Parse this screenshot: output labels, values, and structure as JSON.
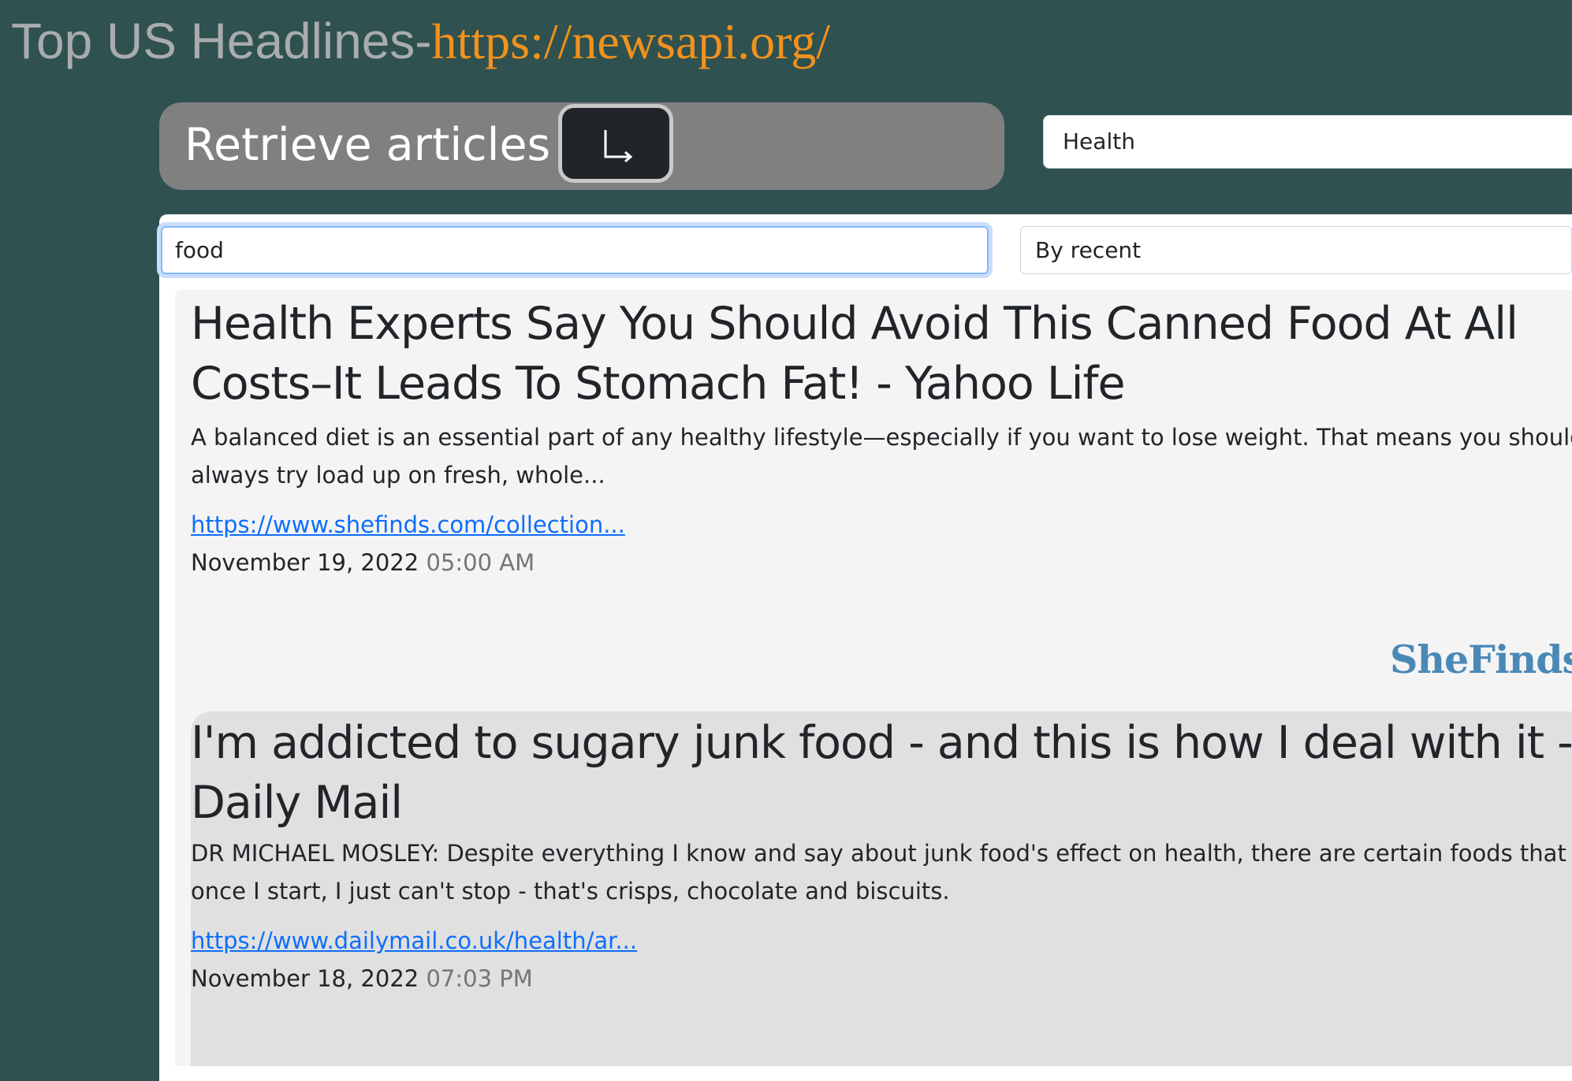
{
  "header": {
    "title": "Top US Headlines-",
    "link": "https://newsapi.org/"
  },
  "controls": {
    "retrieve_label": "Retrieve articles",
    "retrieve_icon": "return-arrow-icon",
    "category_value": "Health",
    "search_value": "food",
    "sort_value": "By recent"
  },
  "articles": [
    {
      "title": "Health Experts Say You Should Avoid This Canned Food At All Costs–It Leads To Stomach Fat! - Yahoo Life",
      "description": "A balanced diet is an essential part of any healthy lifestyle—especially if you want to lose weight. That means you should always try load up on fresh, whole...",
      "url": "https://www.shefinds.com/collection...",
      "date": "November 19, 2022",
      "time": "05:00 AM",
      "source_logo": "SheFinds"
    },
    {
      "title": "I'm addicted to sugary junk food - and this is how I deal with it - Daily Mail",
      "description": "DR MICHAEL MOSLEY: Despite everything I know and say about junk food's effect on health, there are certain foods that once I start, I just can't stop - that's crisps, chocolate and biscuits.",
      "url": "https://www.dailymail.co.uk/health/ar...",
      "date": "November 18, 2022",
      "time": "07:03 PM"
    }
  ],
  "colors": {
    "background": "#2f5150",
    "title_gray": "#a9acad",
    "title_link": "#f1921c",
    "link_blue": "#0d6efd",
    "card_1": "#f4f4f4",
    "card_2": "#e0e0e0",
    "logo_blue": "#4a89b6"
  }
}
